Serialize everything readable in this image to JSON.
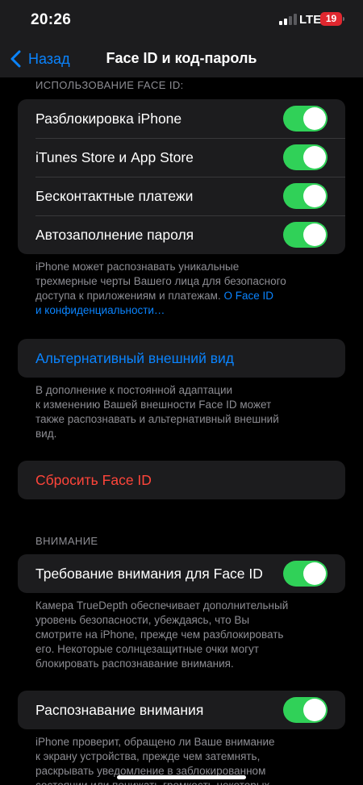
{
  "status": {
    "time": "20:26",
    "network": "LTE",
    "battery": "19"
  },
  "nav": {
    "back_label": "Назад",
    "title": "Face ID и код-пароль"
  },
  "section_faceid": {
    "header": "ИСПОЛЬЗОВАНИЕ FACE ID:",
    "rows": [
      {
        "label": "Разблокировка iPhone",
        "on": true
      },
      {
        "label": "iTunes Store и App Store",
        "on": true
      },
      {
        "label": "Бесконтактные платежи",
        "on": true
      },
      {
        "label": "Автозаполнение пароля",
        "on": true
      }
    ],
    "footer_line1": "iPhone может распознавать уникальные",
    "footer_line2": "трехмерные черты Вашего лица для безопасного",
    "footer_line3": "доступа к приложениям и платежам. ",
    "footer_link1": "О Face ID",
    "footer_link2": "и конфиденциальности…"
  },
  "alternate": {
    "label": "Альтернативный внешний вид",
    "footer_lines": [
      "В дополнение к постоянной адаптации",
      "к изменению Вашей внешности Face ID может",
      "также распознавать и альтернативный внешний",
      "вид."
    ]
  },
  "reset": {
    "label": "Сбросить Face ID"
  },
  "attention": {
    "header": "ВНИМАНИЕ",
    "require_label": "Требование внимания для Face ID",
    "require_on": true,
    "require_footer_lines": [
      "Камера TrueDepth обеспечивает дополнительный",
      "уровень безопасности, убеждаясь, что Вы",
      "смотрите на iPhone, прежде чем разблокировать",
      "его. Некоторые солнцезащитные очки могут",
      "блокировать распознавание внимания."
    ],
    "aware_label": "Распознавание внимания",
    "aware_on": true,
    "aware_footer_lines": [
      "iPhone проверит, обращено ли Ваше внимание",
      "к экрану устройства, прежде чем затемнять,",
      "раскрывать уведомление в заблокированном",
      "состоянии или понижать громкость некоторых"
    ]
  }
}
